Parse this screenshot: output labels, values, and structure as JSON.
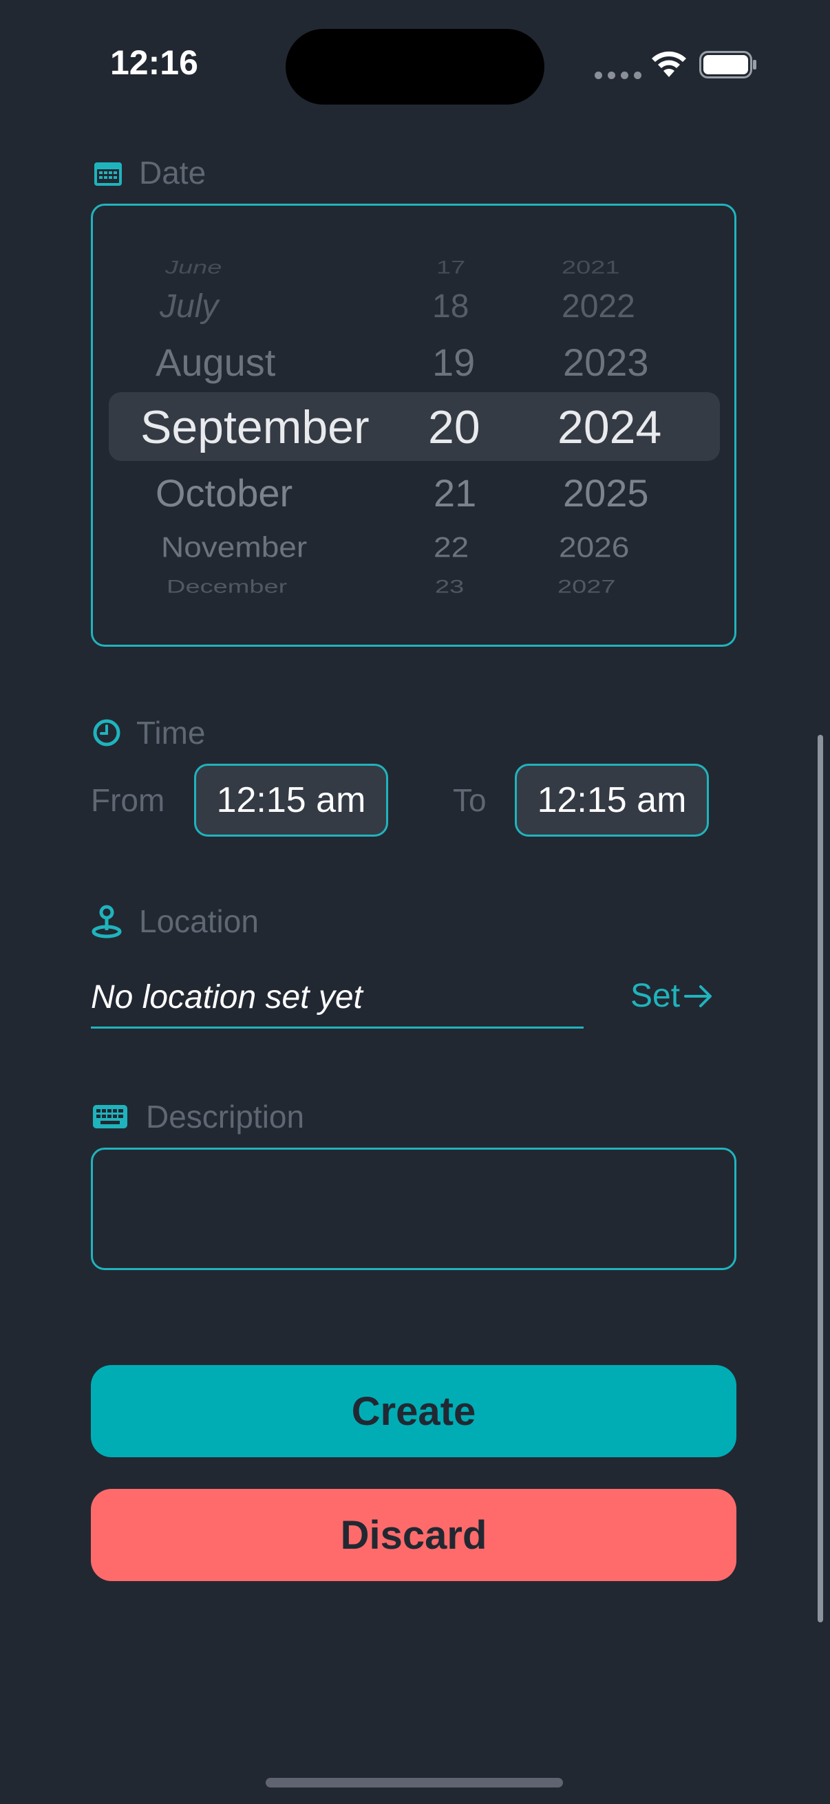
{
  "status_bar": {
    "time": "12:16",
    "icons": [
      "cellular-dots-icon",
      "wifi-icon",
      "battery-icon"
    ]
  },
  "date_section": {
    "label": "Date",
    "icon": "calendar-icon",
    "picker": {
      "months": [
        "June",
        "July",
        "August",
        "September",
        "October",
        "November",
        "December"
      ],
      "days": [
        "17",
        "18",
        "19",
        "20",
        "21",
        "22",
        "23"
      ],
      "years": [
        "2021",
        "2022",
        "2023",
        "2024",
        "2025",
        "2026",
        "2027"
      ],
      "selected": {
        "month": "September",
        "day": "20",
        "year": "2024"
      }
    }
  },
  "time_section": {
    "label": "Time",
    "icon": "clock-icon",
    "from_label": "From",
    "from_value": "12:15 am",
    "to_label": "To",
    "to_value": "12:15 am"
  },
  "location_section": {
    "label": "Location",
    "icon": "map-pin-icon",
    "value": "No location set yet",
    "set_label": "Set"
  },
  "description_section": {
    "label": "Description",
    "icon": "keyboard-icon",
    "value": ""
  },
  "buttons": {
    "create": "Create",
    "discard": "Discard"
  },
  "colors": {
    "background": "#222832",
    "accent": "#00adb5",
    "danger": "#ff6b6b",
    "muted": "#5f6773"
  }
}
